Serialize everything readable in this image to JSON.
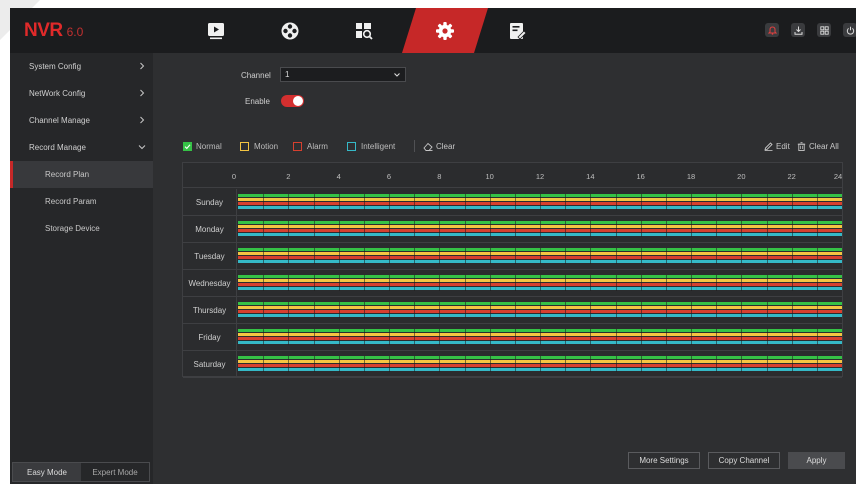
{
  "app": {
    "logo": "NVR",
    "version": "6.0"
  },
  "topnav": [
    {
      "name": "playback-icon"
    },
    {
      "name": "channel-icon"
    },
    {
      "name": "search-icon"
    },
    {
      "name": "settings-icon",
      "active": true
    },
    {
      "name": "maintenance-icon"
    }
  ],
  "toolbar_icons": [
    "alarm-icon",
    "download-icon",
    "grid-icon",
    "power-icon"
  ],
  "sidebar": {
    "menu": [
      {
        "label": "System Config",
        "expanded": false
      },
      {
        "label": "NetWork Config",
        "expanded": false
      },
      {
        "label": "Channel Manage",
        "expanded": false
      },
      {
        "label": "Record Manage",
        "expanded": true
      }
    ],
    "submenu": [
      {
        "label": "Record Plan",
        "active": true
      },
      {
        "label": "Record Param"
      },
      {
        "label": "Storage Device"
      }
    ],
    "modes": {
      "easy": "Easy Mode",
      "expert": "Expert Mode",
      "active": "easy"
    }
  },
  "form": {
    "channel_label": "Channel",
    "channel_value": "1",
    "enable_label": "Enable",
    "enable_on": true
  },
  "legend": [
    {
      "label": "Normal",
      "color": "#35c246",
      "checked": true
    },
    {
      "label": "Motion",
      "color": "#f4c542",
      "checked": false
    },
    {
      "label": "Alarm",
      "color": "#d6402f",
      "checked": false
    },
    {
      "label": "Intelligent",
      "color": "#35b9c7",
      "checked": false
    }
  ],
  "actions": {
    "clear": "Clear",
    "edit": "Edit",
    "clear_all": "Clear All"
  },
  "schedule": {
    "hours": [
      "0",
      "2",
      "4",
      "6",
      "8",
      "10",
      "12",
      "14",
      "16",
      "18",
      "20",
      "22",
      "24"
    ],
    "days": [
      "Sunday",
      "Monday",
      "Tuesday",
      "Wednesday",
      "Thursday",
      "Friday",
      "Saturday"
    ],
    "bar_colors": [
      "#35c246",
      "#f4c542",
      "#d6402f",
      "#35b9c7"
    ]
  },
  "buttons": {
    "more_settings": "More Settings",
    "copy_channel": "Copy Channel",
    "apply": "Apply"
  },
  "colors": {
    "accent": "#c62828",
    "topbar": "#1b1c1e",
    "sidebar": "#262729",
    "content": "#2e2f31"
  }
}
